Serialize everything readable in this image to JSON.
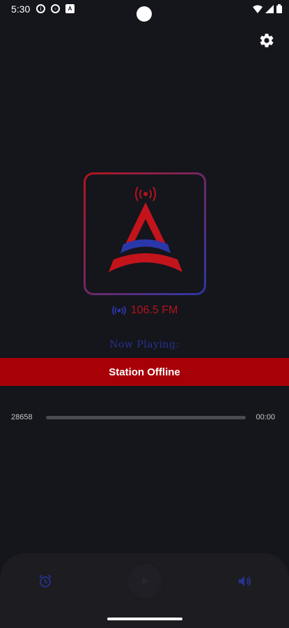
{
  "status_bar": {
    "time": "5:30",
    "icons_left": [
      "info-icon",
      "shield-icon",
      "notification-a-icon"
    ],
    "icons_right": [
      "wifi-icon",
      "signal-icon",
      "battery-icon"
    ],
    "notification_letter": "A"
  },
  "header": {
    "settings_icon": "gear-icon"
  },
  "station": {
    "frequency": "106.5 FM",
    "now_playing_label": "Now Playing:",
    "status": "Station Offline"
  },
  "progress": {
    "elapsed": "28658",
    "duration": "00:00",
    "fraction": 0.0
  },
  "controls": {
    "alarm_icon": "alarm-icon",
    "play_icon": "play-icon",
    "volume_icon": "volume-icon"
  },
  "colors": {
    "background": "#15151c",
    "accent_red": "#a70007",
    "logo_red": "#b3141c",
    "logo_blue": "#2a37a8",
    "now_playing_blue": "#253490"
  }
}
